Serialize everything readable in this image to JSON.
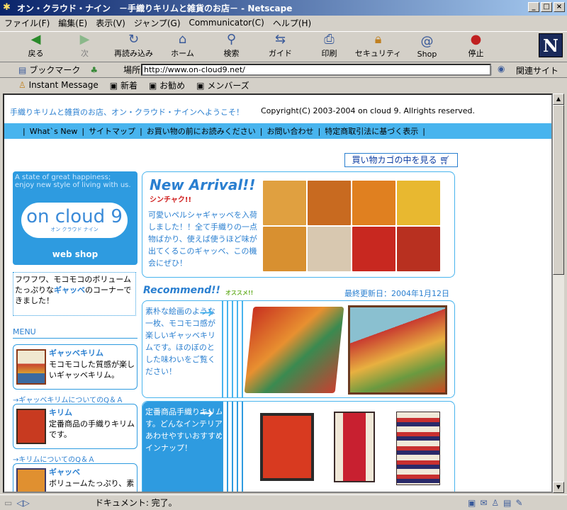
{
  "window": {
    "title": "オン・クラウド・ナイン　－手織りキリムと雑貨のお店－ - Netscape"
  },
  "menu": [
    "ファイル(F)",
    "編集(E)",
    "表示(V)",
    "ジャンプ(G)",
    "Communicator(C)",
    "ヘルプ(H)"
  ],
  "toolbar": [
    {
      "label": "戻る",
      "icon": "back-arrow"
    },
    {
      "label": "次",
      "icon": "forward-arrow"
    },
    {
      "label": "再読み込み",
      "icon": "reload"
    },
    {
      "label": "ホーム",
      "icon": "home"
    },
    {
      "label": "検索",
      "icon": "search"
    },
    {
      "label": "ガイド",
      "icon": "guide"
    },
    {
      "label": "印刷",
      "icon": "printer"
    },
    {
      "label": "セキュリティ",
      "icon": "lock"
    },
    {
      "label": "Shop",
      "icon": "shop"
    },
    {
      "label": "停止",
      "icon": "stop"
    }
  ],
  "location": {
    "bookmarks": "ブックマーク",
    "label": "場所:",
    "url": "http://www.on-cloud9.net/",
    "related": "関連サイト"
  },
  "personal": [
    "Instant Message",
    "新着",
    "お勧め",
    "メンバーズ"
  ],
  "page": {
    "greeting": "手織りキリムと雑貨のお店、オン・クラウド・ナインへようこそ！",
    "copyright": "Copyright(C) 2003-2004 on cloud 9. Allrights reserved.",
    "nav": [
      "What`s New",
      "サイトマップ",
      "お買い物の前にお読みください",
      "お問い合わせ",
      "特定商取引法に基づく表示"
    ],
    "cart": "買い物カゴの中を見る",
    "banner": {
      "tagline1": "A state of great happiness;",
      "tagline2": "enjoy new style of living with us.",
      "logo": "on cloud 9",
      "logo_kana": "オン クラウド ナイン",
      "shop": "web shop"
    },
    "fuwa": {
      "text1": "フワフワ、モコモコのボリューム",
      "text2": "たっぷりな",
      "highlight": "ギャッベ",
      "text3": "のコーナーできました！"
    },
    "menu_head": "MENU",
    "items": [
      {
        "title": "ギャッベキリム",
        "desc": "モコモコした質感が楽しいギャッベキリム。"
      },
      {
        "title": "キリム",
        "desc": "定番商品の手織りキリムです。"
      },
      {
        "title": "ギャッベ",
        "desc": "ボリュームたっぷり、素"
      }
    ],
    "qa": [
      "→ギャッベキリムについてのQ＆Ａ",
      "→キリムについてのQ＆Ａ"
    ],
    "new_arrival": {
      "title": "New Arrival!!",
      "sub": "シンチャク!!",
      "text": "可愛いペルシャギャッベを入荷しました！！全て手織りの一点物ばかり、使えば使うほど味が出てくるこのギャッベ、この機会にぜひ！"
    },
    "recommend": {
      "title": "Recommend!!",
      "sub": "オススメ!!",
      "updated": "最終更新日：2004年1月12日",
      "text1": "素朴な絵画のような一枚、モコモコ感が楽しいギャッベキリムです。ほのぼのとした味わいをご覧ください！",
      "text2": "定番商品手織りキリムです。どんなインテリアにもあわせやすいおすすめのラインナップ！"
    }
  },
  "status": "ドキュメント: 完了。"
}
